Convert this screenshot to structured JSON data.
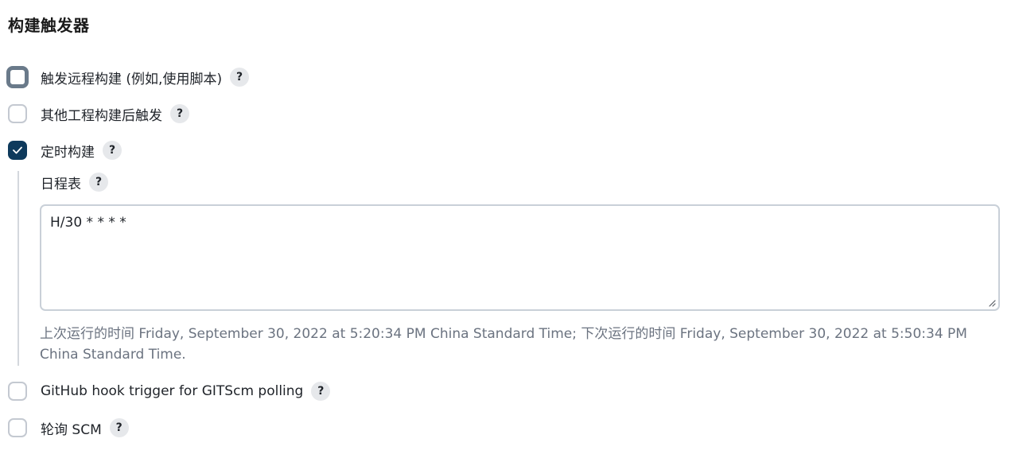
{
  "section": {
    "title": "构建触发器"
  },
  "triggers": [
    {
      "label": "触发远程构建 (例如,使用脚本)",
      "checked": false,
      "focused": true
    },
    {
      "label": "其他工程构建后触发",
      "checked": false,
      "focused": false
    },
    {
      "label": "定时构建",
      "checked": true,
      "focused": false
    },
    {
      "label": "GitHub hook trigger for GITScm polling",
      "checked": false,
      "focused": false
    },
    {
      "label": "轮询 SCM",
      "checked": false,
      "focused": false
    }
  ],
  "schedule": {
    "label": "日程表",
    "value": "H/30 * * * *",
    "info": "上次运行的时间 Friday, September 30, 2022 at 5:20:34 PM China Standard Time; 下次运行的时间 Friday, September 30, 2022 at 5:50:34 PM China Standard Time."
  },
  "help_glyph": "?",
  "colors": {
    "checked_bg": "#0e3a5c",
    "focus_border": "#6a7a8a",
    "help_bg": "#e6e8eb",
    "info_text": "#6b7380"
  }
}
